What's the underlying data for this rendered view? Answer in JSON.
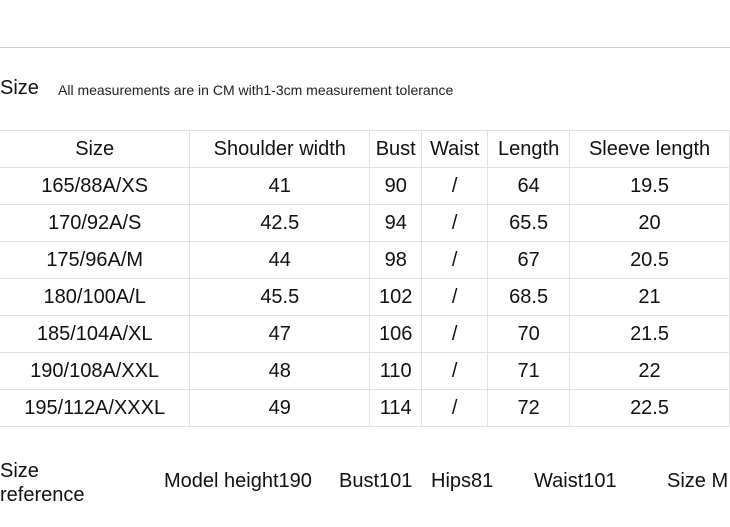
{
  "section": {
    "title": "Size",
    "note": "All measurements are in CM with1-3cm measurement tolerance"
  },
  "table": {
    "headers": [
      "Size",
      "Shoulder width",
      "Bust",
      "Waist",
      "Length",
      "Sleeve length"
    ],
    "rows": [
      [
        "165/88A/XS",
        "41",
        "90",
        "/",
        "64",
        "19.5"
      ],
      [
        "170/92A/S",
        "42.5",
        "94",
        "/",
        "65.5",
        "20"
      ],
      [
        "175/96A/M",
        "44",
        "98",
        "/",
        "67",
        "20.5"
      ],
      [
        "180/100A/L",
        "45.5",
        "102",
        "/",
        "68.5",
        "21"
      ],
      [
        "185/104A/XL",
        "47",
        "106",
        "/",
        "70",
        "21.5"
      ],
      [
        "190/108A/XXL",
        "48",
        "110",
        "/",
        "71",
        "22"
      ],
      [
        "195/112A/XXXL",
        "49",
        "114",
        "/",
        "72",
        "22.5"
      ]
    ]
  },
  "reference": {
    "label_line1": "Size",
    "label_line2": "reference",
    "model_height": "Model height190",
    "bust": "Bust101",
    "hips": "Hips81",
    "waist": "Waist101",
    "size": "Size M"
  }
}
